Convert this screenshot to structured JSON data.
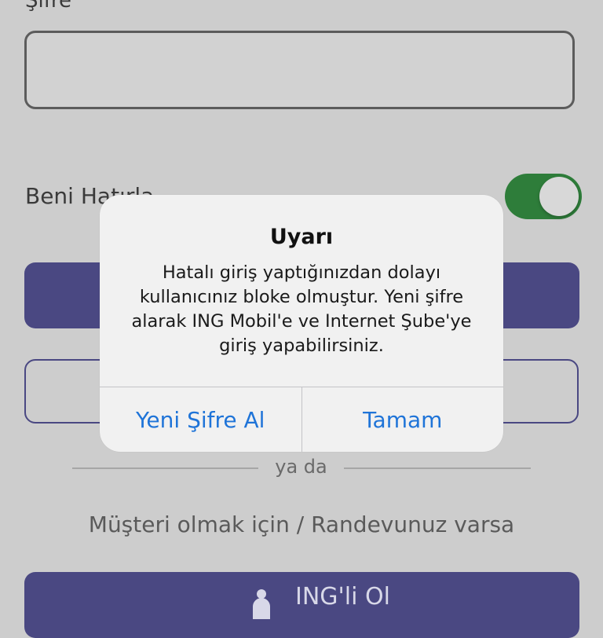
{
  "form": {
    "password_label": "Şifre",
    "password_value": "",
    "remember_label": "Beni Hatırla",
    "remember_on": true,
    "divider_text": "ya da",
    "customer_text": "Müşteri olmak için / Randevunuz varsa",
    "join_label": "ING'li Ol"
  },
  "alert": {
    "title": "Uyarı",
    "message": "Hatalı giriş yaptığınızdan dolayı kullanıcınız bloke olmuştur. Yeni şifre alarak ING Mobil'e ve Internet Şube'ye giriş yapabilirsiniz.",
    "buttons": {
      "new_password": "Yeni Şifre Al",
      "ok": "Tamam"
    }
  },
  "colors": {
    "accent_blue": "#1f74d8",
    "brand_purple": "#4a4882",
    "toggle_green": "#2e7d3a"
  },
  "icons": {
    "join_icon": "person-icon"
  }
}
